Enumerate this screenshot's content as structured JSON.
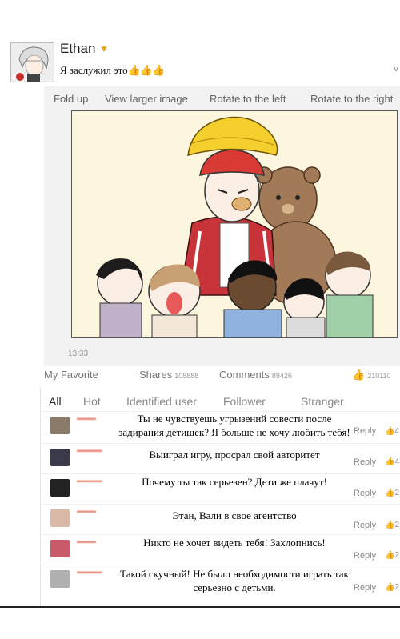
{
  "post": {
    "username": "Ethan",
    "text": "Я заслужил это",
    "thumbs": "👍👍👍",
    "time": "13:33"
  },
  "toolbar": {
    "fold_up": "Fold up",
    "view_larger": "View larger image",
    "rotate_left": "Rotate to the left",
    "rotate_right": "Rotate to the right"
  },
  "actions": {
    "favorite": "My Favorite",
    "shares_label": "Shares",
    "shares_count": "108888",
    "comments_label": "Comments",
    "comments_count": "89426",
    "likes_count": "210110"
  },
  "comment_tabs": [
    "All",
    "Hot",
    "Identified user",
    "Follower",
    "Stranger"
  ],
  "comments": [
    {
      "text": "Ты не чувствуешь угрызений совести после задирания детишек? Я больше не хочу любить тебя!",
      "reply": "Reply",
      "likes": "4"
    },
    {
      "text": "Выиграл игру, просрал свой авторитет",
      "reply": "Reply",
      "likes": "4"
    },
    {
      "text": "Почему ты так серьезен? Дети же плачут!",
      "reply": "Reply",
      "likes": "2"
    },
    {
      "text": "Этан, Вали в свое агентство",
      "reply": "Reply",
      "likes": "2"
    },
    {
      "text": "Никто не хочет видеть тебя! Захлопнись!",
      "reply": "Reply",
      "likes": "2"
    },
    {
      "text": "Такой скучный! Не было необходимости играть так серьезно с детьми.",
      "reply": "Reply",
      "likes": "2"
    }
  ],
  "colors": {
    "accent": "#e88a7a",
    "comic_bg": "#fdf6df",
    "hat": "#f4cf2e",
    "cap": "#d93a34",
    "jacket": "#c8343a",
    "bear": "#a37a57"
  }
}
